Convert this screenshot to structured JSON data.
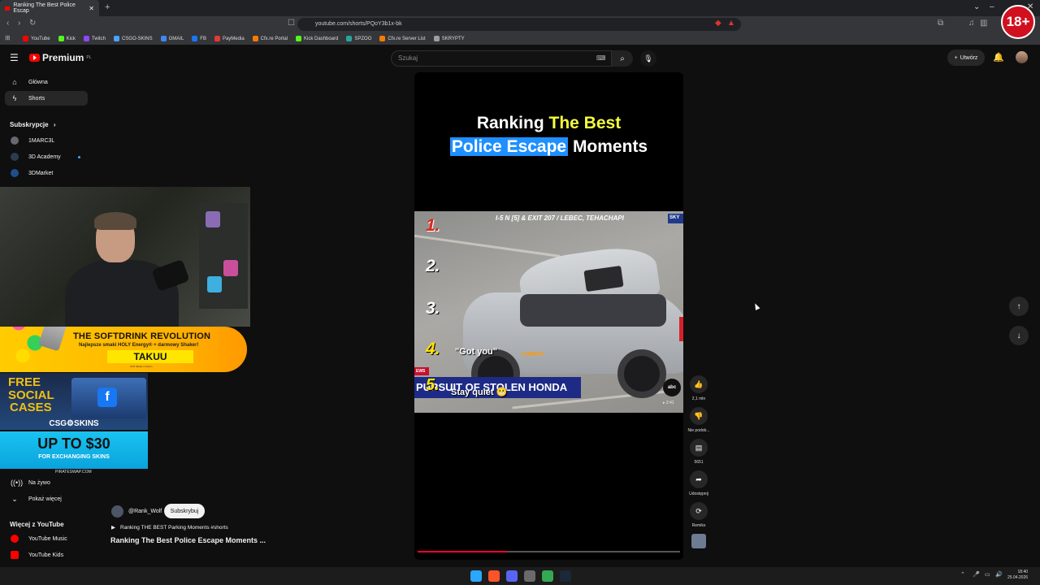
{
  "browser": {
    "tab_title": "Ranking The Best Police Escap",
    "url": "youtube.com/shorts/PQoY3b1x-bk",
    "bookmarks": [
      {
        "label": "YouTube",
        "color": "#ff0000"
      },
      {
        "label": "Kick",
        "color": "#53fc18"
      },
      {
        "label": "Twitch",
        "color": "#9146ff"
      },
      {
        "label": "CSGO-SKINS",
        "color": "#4aa3ff"
      },
      {
        "label": "GMAIL",
        "color": "#4285f4"
      },
      {
        "label": "FB",
        "color": "#1877f2"
      },
      {
        "label": "PayMedia",
        "color": "#e53935"
      },
      {
        "label": "Cfx.re Portal",
        "color": "#f57c00"
      },
      {
        "label": "Kick Dashboard",
        "color": "#53fc18"
      },
      {
        "label": "SPZOO",
        "color": "#26a69a"
      },
      {
        "label": "Cfx.re Server List",
        "color": "#f57c00"
      },
      {
        "label": "SKRYPTY",
        "color": "#9e9e9e"
      }
    ],
    "age_badge": "18+"
  },
  "header": {
    "logo_text": "Premium",
    "logo_region": "PL",
    "search_placeholder": "Szukaj",
    "create_label": "Utwórz"
  },
  "sidebar": {
    "items": [
      {
        "label": "Główna",
        "icon": "home-icon"
      },
      {
        "label": "Shorts",
        "icon": "shorts-icon"
      }
    ],
    "subscriptions_heading": "Subskrypcje",
    "subscriptions": [
      {
        "label": "1MARC3L",
        "color": "#666a70"
      },
      {
        "label": "3D Academy",
        "color": "#2d3b52"
      },
      {
        "label": "3DMarket",
        "color": "#1f4f8a"
      }
    ],
    "live_label": "Na żywo",
    "show_more_label": "Pokaż więcej",
    "more_heading": "Więcej z YouTube",
    "more_items": [
      {
        "label": "YouTube Music",
        "color": "#ff0000"
      },
      {
        "label": "YouTube Kids",
        "color": "#ff0000"
      }
    ]
  },
  "overlay": {
    "ad1_title": "THE SOFTDRINK REVOLUTION",
    "ad1_sub": "Najlepsze smaki HOLY Energy® + darmowy Shaker!",
    "ad1_code": "TAKUU",
    "ad1_fine": "10% rabatu z kodem",
    "ad2_line1": "FREE",
    "ad2_line2": "SOCIAL",
    "ad2_line3": "CASES",
    "ad2_brand": "CSG⚙SKINS",
    "ad2_offer": "UP TO $30",
    "ad2_fine": "FOR EXCHANGING SKINS",
    "ad2_site": "PIRATESWAP.COM"
  },
  "video": {
    "title_line1_a": "Ranking ",
    "title_line1_b": "The Best",
    "title_line2_a": "Police Escape",
    "title_line2_b": " Moments",
    "news_top": "I-5 N [5] & EXIT 207 / LEBEC, TEHACHAPI",
    "sky_tag": "SKY",
    "ranks": [
      "1.",
      "2.",
      "3.",
      "4.",
      "5."
    ],
    "caption1": "\"Got you\"",
    "speed": "116MPH",
    "news_tag": "EWS",
    "chyron": "PURSUIT OF STOLEN HONDA",
    "caption2": "Stay quiet 😬",
    "network": "abc",
    "time": "▸ 2:41",
    "progress": 0.34
  },
  "actions": {
    "like_count": "2,1 mln",
    "dislike_label": "Nie podob...",
    "comments_count": "5651",
    "share_label": "Udostępnij",
    "remix_label": "Remiks"
  },
  "channel": {
    "handle": "@Rank_Wolf",
    "subscribe_label": "Subskrybuj",
    "playlist": "Ranking THE BEST Parking Moments #shorts",
    "video_title": "Ranking The Best Police Escape Moments ..."
  },
  "taskbar": {
    "time": "18:40",
    "date": "25.04.2026",
    "apps": [
      {
        "name": "windows-start-icon",
        "color": "#2aa7ff"
      },
      {
        "name": "brave-browser-icon",
        "color": "#fb542b"
      },
      {
        "name": "discord-icon",
        "color": "#5865f2"
      },
      {
        "name": "terminal-icon",
        "color": "#6a6a6a"
      },
      {
        "name": "chrome-icon",
        "color": "#34a853"
      },
      {
        "name": "steam-icon",
        "color": "#1b2838"
      }
    ]
  }
}
